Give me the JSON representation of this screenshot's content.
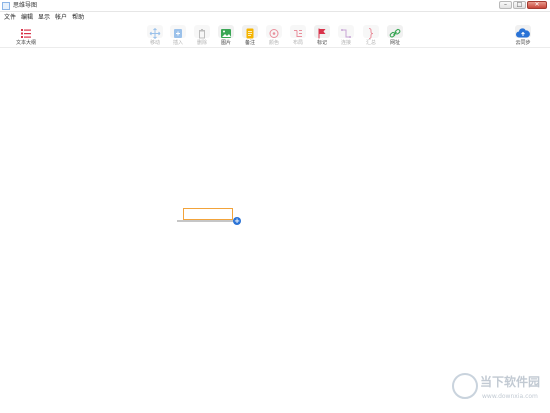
{
  "window": {
    "title": "思维导图"
  },
  "menu": {
    "items": [
      "文件",
      "编辑",
      "显示",
      "帐户",
      "帮助"
    ]
  },
  "toolbar": {
    "outline_label": "文本大纲",
    "tools": [
      {
        "label": "移动",
        "icon": "move-icon",
        "enabled": false
      },
      {
        "label": "插入",
        "icon": "insert-icon",
        "enabled": false
      },
      {
        "label": "删除",
        "icon": "trash-icon",
        "enabled": false
      },
      {
        "label": "图片",
        "icon": "image-icon",
        "enabled": true
      },
      {
        "label": "备注",
        "icon": "note-icon",
        "enabled": true
      },
      {
        "label": "颜色",
        "icon": "palette-icon",
        "enabled": false
      },
      {
        "label": "布局",
        "icon": "layout-icon",
        "enabled": false
      },
      {
        "label": "标记",
        "icon": "flag-icon",
        "enabled": true
      },
      {
        "label": "连接",
        "icon": "connect-icon",
        "enabled": false
      },
      {
        "label": "汇总",
        "icon": "summary-brace-icon",
        "enabled": false
      },
      {
        "label": "网址",
        "icon": "link-icon",
        "enabled": true
      }
    ],
    "sync_label": "云同步"
  },
  "canvas": {
    "node_text": ""
  },
  "watermark": {
    "title": "当下软件园",
    "url": "www.downxia.com"
  },
  "colors": {
    "accent": "#2a73d6",
    "node_border": "#f2a33a",
    "flag": "#d8324a"
  }
}
